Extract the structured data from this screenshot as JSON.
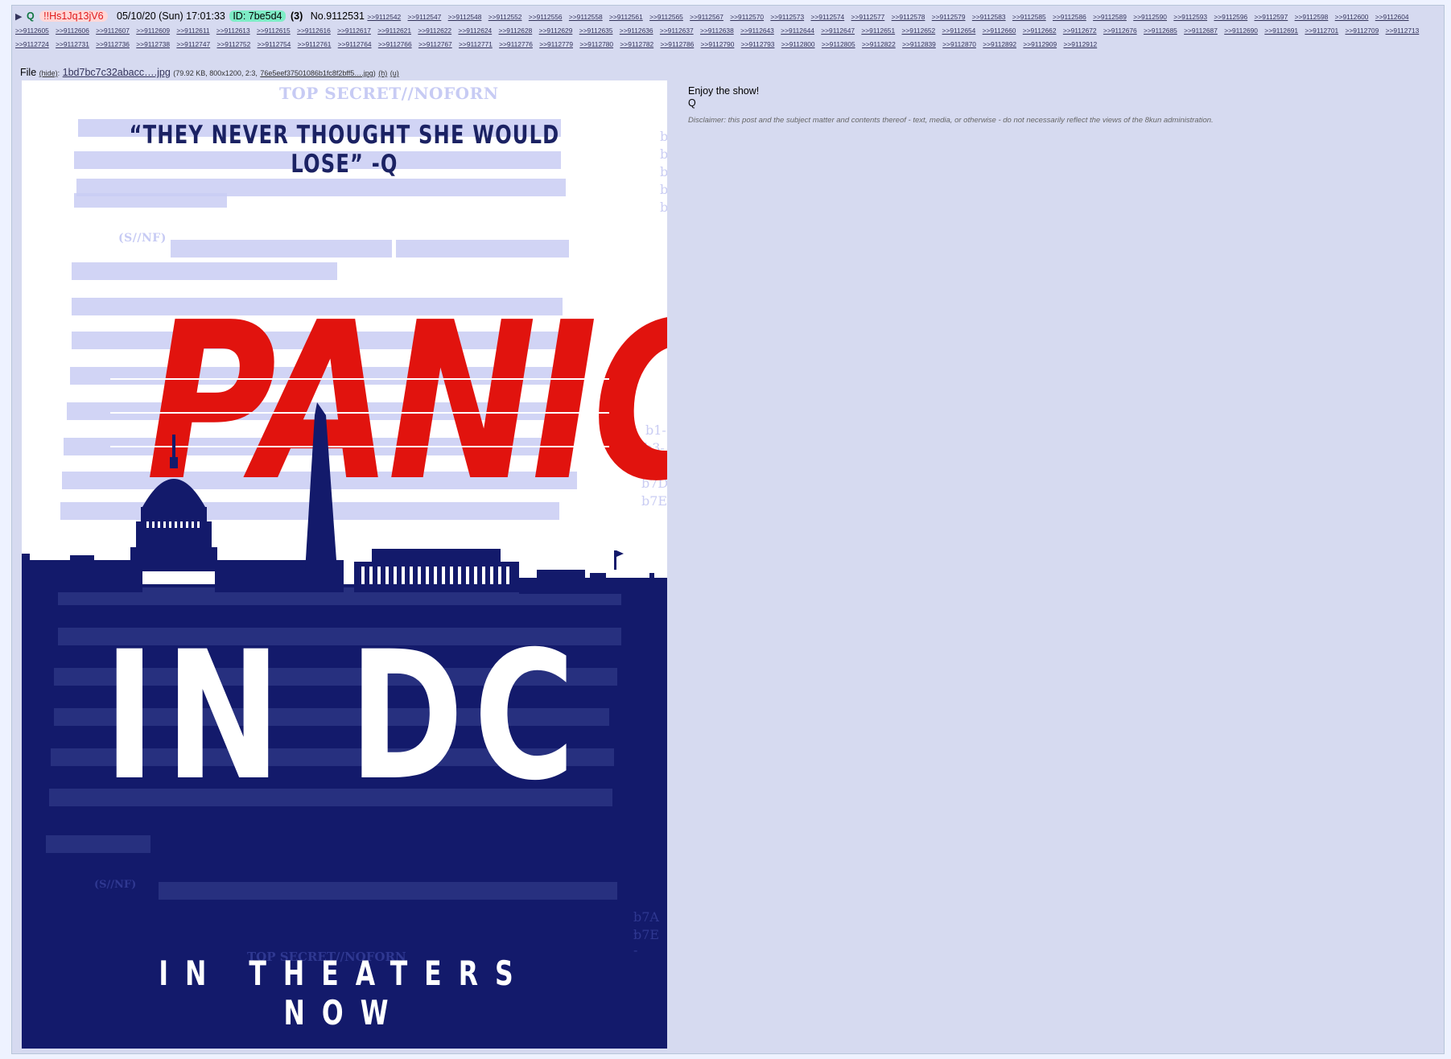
{
  "post": {
    "name": "Q",
    "tripcode": "!!Hs1Jq13jV6",
    "date": "05/10/20 (Sun) 17:01:33",
    "id_label": "ID: 7be5d4",
    "id_count": "(3)",
    "post_no": "No.9112531",
    "backlinks": [
      ">>9112542",
      ">>9112547",
      ">>9112548",
      ">>9112552",
      ">>9112556",
      ">>9112558",
      ">>9112561",
      ">>9112565",
      ">>9112567",
      ">>9112570",
      ">>9112573",
      ">>9112574",
      ">>9112577",
      ">>9112578",
      ">>9112579",
      ">>9112583",
      ">>9112585",
      ">>9112586",
      ">>9112589",
      ">>9112590",
      ">>9112593",
      ">>9112596",
      ">>9112597",
      ">>9112598",
      ">>9112600",
      ">>9112604",
      ">>9112605",
      ">>9112606",
      ">>9112607",
      ">>9112609",
      ">>9112611",
      ">>9112613",
      ">>9112615",
      ">>9112616",
      ">>9112617",
      ">>9112621",
      ">>9112622",
      ">>9112624",
      ">>9112628",
      ">>9112629",
      ">>9112635",
      ">>9112636",
      ">>9112637",
      ">>9112638",
      ">>9112643",
      ">>9112644",
      ">>9112647",
      ">>9112651",
      ">>9112652",
      ">>9112654",
      ">>9112660",
      ">>9112662",
      ">>9112672",
      ">>9112676",
      ">>9112685",
      ">>9112687",
      ">>9112690",
      ">>9112691",
      ">>9112701",
      ">>9112709",
      ">>9112713",
      ">>9112724",
      ">>9112731",
      ">>9112736",
      ">>9112738",
      ">>9112747",
      ">>9112752",
      ">>9112754",
      ">>9112761",
      ">>9112764",
      ">>9112766",
      ">>9112767",
      ">>9112771",
      ">>9112776",
      ">>9112779",
      ">>9112780",
      ">>9112782",
      ">>9112786",
      ">>9112790",
      ">>9112793",
      ">>9112800",
      ">>9112805",
      ">>9112822",
      ">>9112839",
      ">>9112870",
      ">>9112892",
      ">>9112909",
      ">>9112912"
    ]
  },
  "file": {
    "label": "File",
    "hide": "(hide)",
    "name": "1bd7bc7c32abacc….jpg",
    "meta": "(79.92 KB, 800x1200, 2:3,",
    "orig_name": "76e5eef37501086b1fc8f2bff5….jpg",
    "meta_end": ")",
    "h": "(h)",
    "u": "(u)"
  },
  "poster": {
    "stamp_top": "TOP SECRET//NOFORN",
    "quote": "“THEY NEVER THOUGHT SHE WOULD LOSE” -Q",
    "headline": "PANIC",
    "subheadline": "IN DC",
    "tagline": "IN THEATERS NOW",
    "stamp_bottom": "TOP SECRET//NOFORN",
    "redact_tag_1": "(S//NF)",
    "redact_tag_2": "(S//NF)",
    "side_codes": [
      "b1-",
      "b3-",
      "b7A",
      "b7D",
      "b7E"
    ],
    "side_codes_top": [
      "b",
      "b",
      "b",
      "b",
      "b"
    ],
    "side_codes_bottom": [
      "b7A -",
      "b7E -"
    ]
  },
  "comment": {
    "line1": "Enjoy the show!",
    "line2": "Q",
    "disclaimer": "Disclaimer: this post and the subject matter and contents thereof - text, media, or otherwise - do not necessarily reflect the views of the 8kun administration."
  }
}
